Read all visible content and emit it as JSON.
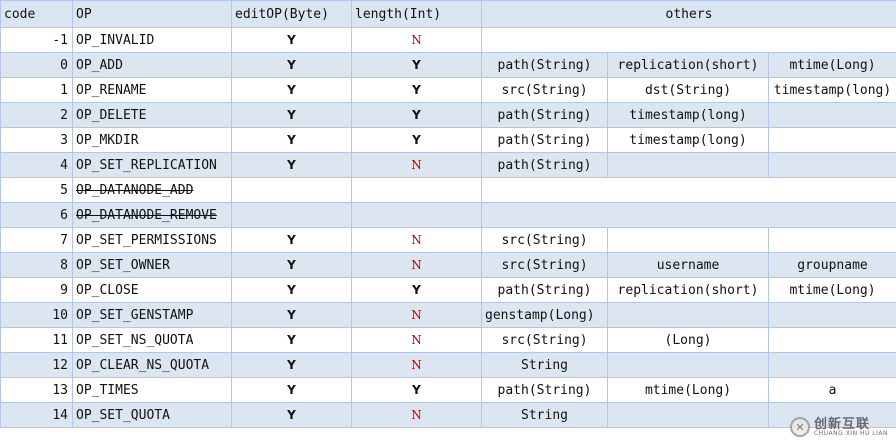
{
  "headers": {
    "code": "code",
    "op": "OP",
    "edit": "editOP(Byte)",
    "length": "length(Int)",
    "others": "others"
  },
  "rows": [
    {
      "code": "-1",
      "op": "OP_INVALID",
      "strike": false,
      "edit": "Y",
      "length": "N",
      "others": [],
      "others_span": 3
    },
    {
      "code": "0",
      "op": "OP_ADD",
      "strike": false,
      "edit": "Y",
      "length": "Y",
      "others": [
        "path(String)",
        "replication(short)",
        "mtime(Long)"
      ]
    },
    {
      "code": "1",
      "op": "OP_RENAME",
      "strike": false,
      "edit": "Y",
      "length": "Y",
      "others": [
        "src(String)",
        "dst(String)",
        "timestamp(long)"
      ]
    },
    {
      "code": "2",
      "op": "OP_DELETE",
      "strike": false,
      "edit": "Y",
      "length": "Y",
      "others": [
        "path(String)",
        "timestamp(long)",
        ""
      ]
    },
    {
      "code": "3",
      "op": "OP_MKDIR",
      "strike": false,
      "edit": "Y",
      "length": "Y",
      "others": [
        "path(String)",
        "timestamp(long)",
        ""
      ]
    },
    {
      "code": "4",
      "op": "OP_SET_REPLICATION",
      "strike": false,
      "edit": "Y",
      "length": "N",
      "others": [
        "path(String)",
        "",
        ""
      ]
    },
    {
      "code": "5",
      "op": "OP_DATANODE_ADD",
      "strike": true,
      "edit": "",
      "length": "",
      "others": [],
      "others_span": 3
    },
    {
      "code": "6",
      "op": "OP_DATANODE_REMOVE",
      "strike": true,
      "edit": "",
      "length": "",
      "others": [],
      "others_span": 3
    },
    {
      "code": "7",
      "op": "OP_SET_PERMISSIONS",
      "strike": false,
      "edit": "Y",
      "length": "N",
      "others": [
        "src(String)",
        "",
        ""
      ]
    },
    {
      "code": "8",
      "op": "OP_SET_OWNER",
      "strike": false,
      "edit": "Y",
      "length": "N",
      "others": [
        "src(String)",
        "username",
        "groupname"
      ]
    },
    {
      "code": "9",
      "op": "OP_CLOSE",
      "strike": false,
      "edit": "Y",
      "length": "Y",
      "others": [
        "path(String)",
        "replication(short)",
        "mtime(Long)"
      ]
    },
    {
      "code": "10",
      "op": "OP_SET_GENSTAMP",
      "strike": false,
      "edit": "Y",
      "length": "N",
      "others": [
        "genstamp(Long)",
        "",
        ""
      ],
      "first_left": true
    },
    {
      "code": "11",
      "op": "OP_SET_NS_QUOTA",
      "strike": false,
      "edit": "Y",
      "length": "N",
      "others": [
        "src(String)",
        "(Long)",
        ""
      ]
    },
    {
      "code": "12",
      "op": "OP_CLEAR_NS_QUOTA",
      "strike": false,
      "edit": "Y",
      "length": "N",
      "others": [
        "String",
        "",
        ""
      ]
    },
    {
      "code": "13",
      "op": "OP_TIMES",
      "strike": false,
      "edit": "Y",
      "length": "Y",
      "others": [
        "path(String)",
        "mtime(Long)",
        "a"
      ]
    },
    {
      "code": "14",
      "op": "OP_SET_QUOTA",
      "strike": false,
      "edit": "Y",
      "length": "N",
      "others": [
        "String",
        "",
        ""
      ]
    }
  ],
  "watermark": {
    "logo": "✕",
    "text": "创新互联",
    "subtext": "CHUANG XIN HU LIAN"
  },
  "colors": {
    "header_bg": "#dbe5f1",
    "stripe_bg": "#dce6f1",
    "border": "#b4c6e7",
    "no_mark": "#c00000"
  }
}
